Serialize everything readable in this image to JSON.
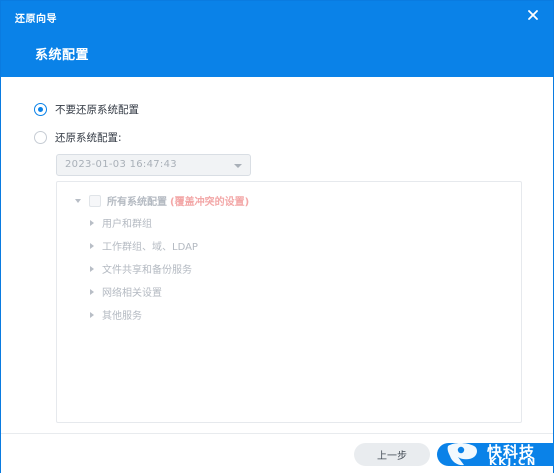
{
  "window": {
    "title": "还原向导",
    "page_title": "系统配置",
    "close_icon": "close-icon"
  },
  "options": {
    "no_restore_label": "不要还原系统配置",
    "restore_label": "还原系统配置:",
    "selected": "no_restore"
  },
  "backup_select": {
    "value": "2023-01-03 16:47:43"
  },
  "tree": {
    "root_label": "所有系统配置",
    "root_note": "(覆盖冲突的设置)",
    "items": [
      {
        "label": "用户和群组"
      },
      {
        "label": "工作群组、域、LDAP"
      },
      {
        "label": "文件共享和备份服务"
      },
      {
        "label": "网络相关设置"
      },
      {
        "label": "其他服务"
      }
    ]
  },
  "footer": {
    "prev_label": "上一步"
  },
  "watermark": {
    "text": "快科技",
    "sub": "KKJ.CN"
  },
  "colors": {
    "accent": "#0a82e8",
    "note_red": "#f3a8a8"
  }
}
